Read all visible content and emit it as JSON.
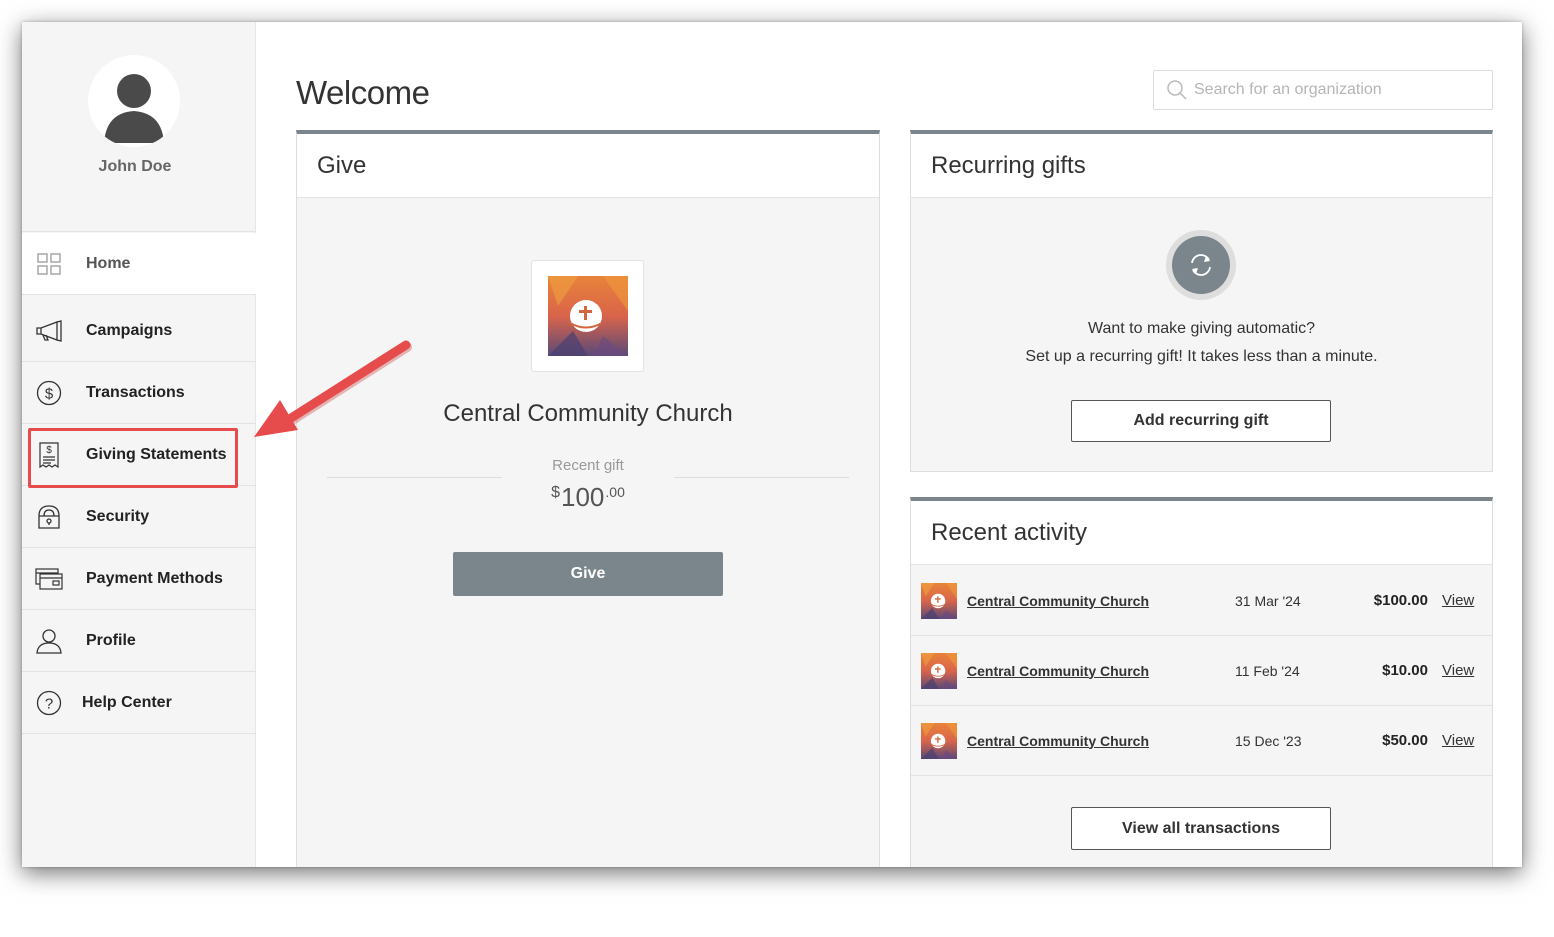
{
  "user": {
    "name": "John Doe"
  },
  "sidebar": {
    "items": [
      {
        "label": "Home",
        "icon": "grid-icon"
      },
      {
        "label": "Campaigns",
        "icon": "megaphone-icon"
      },
      {
        "label": "Transactions",
        "icon": "dollar-circle-icon"
      },
      {
        "label": "Giving Statements",
        "icon": "receipt-icon"
      },
      {
        "label": "Security",
        "icon": "lock-icon"
      },
      {
        "label": "Payment Methods",
        "icon": "credit-card-icon"
      },
      {
        "label": "Profile",
        "icon": "person-icon"
      },
      {
        "label": "Help Center",
        "icon": "question-circle-icon"
      }
    ]
  },
  "header": {
    "title": "Welcome",
    "search_placeholder": "Search for an organization"
  },
  "give": {
    "title": "Give",
    "org_name": "Central Community Church",
    "recent_label": "Recent gift",
    "amount_currency": "$",
    "amount_main": "100",
    "amount_cents": ".00",
    "button_label": "Give"
  },
  "recurring": {
    "title": "Recurring gifts",
    "line1": "Want to make giving automatic?",
    "line2": "Set up a recurring gift! It takes less than a minute.",
    "button_label": "Add recurring gift"
  },
  "activity": {
    "title": "Recent activity",
    "rows": [
      {
        "org": "Central Community Church",
        "date": "31 Mar '24",
        "amount": "$100.00",
        "action": "View"
      },
      {
        "org": "Central Community Church",
        "date": "11 Feb '24",
        "amount": "$10.00",
        "action": "View"
      },
      {
        "org": "Central Community Church",
        "date": "15 Dec '23",
        "amount": "$50.00",
        "action": "View"
      }
    ],
    "button_label": "View all transactions"
  },
  "colors": {
    "accent_gray": "#7b868c",
    "highlight_red": "#e74c4c"
  }
}
